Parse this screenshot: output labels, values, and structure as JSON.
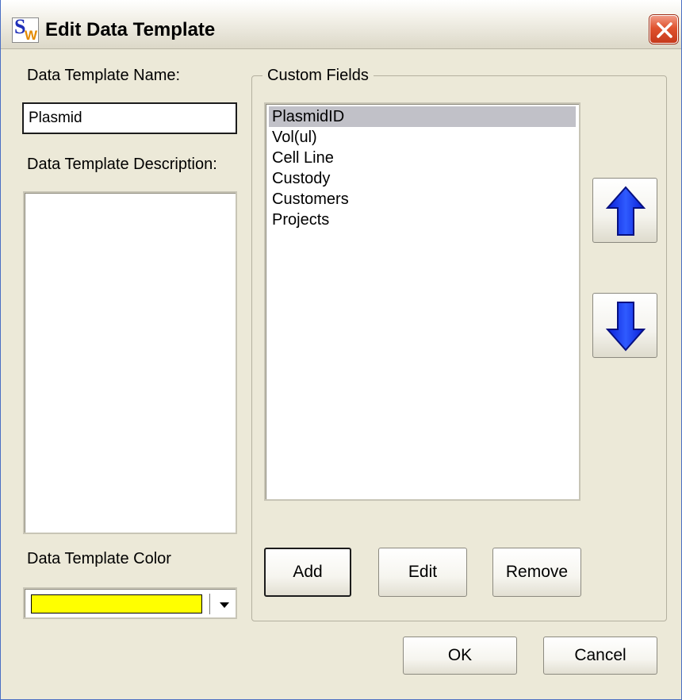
{
  "window": {
    "title": "Edit Data Template",
    "app_icon": "sw-logo-icon"
  },
  "left": {
    "name_label": "Data Template Name:",
    "name_value": "Plasmid",
    "description_label": "Data Template Description:",
    "description_value": "",
    "color_label": "Data Template Color",
    "color_value": "#ffff00"
  },
  "custom_fields": {
    "legend": "Custom Fields",
    "items": [
      {
        "label": "PlasmidID",
        "selected": true
      },
      {
        "label": "Vol(ul)",
        "selected": false
      },
      {
        "label": "Cell Line",
        "selected": false
      },
      {
        "label": "Custody",
        "selected": false
      },
      {
        "label": "Customers",
        "selected": false
      },
      {
        "label": "Projects",
        "selected": false
      }
    ],
    "add_label": "Add",
    "edit_label": "Edit",
    "remove_label": "Remove",
    "move_up_icon": "arrow-up-icon",
    "move_down_icon": "arrow-down-icon"
  },
  "footer": {
    "ok_label": "OK",
    "cancel_label": "Cancel"
  },
  "colors": {
    "arrow_blue": "#1a3cff",
    "selection": "#c1c1c8"
  }
}
